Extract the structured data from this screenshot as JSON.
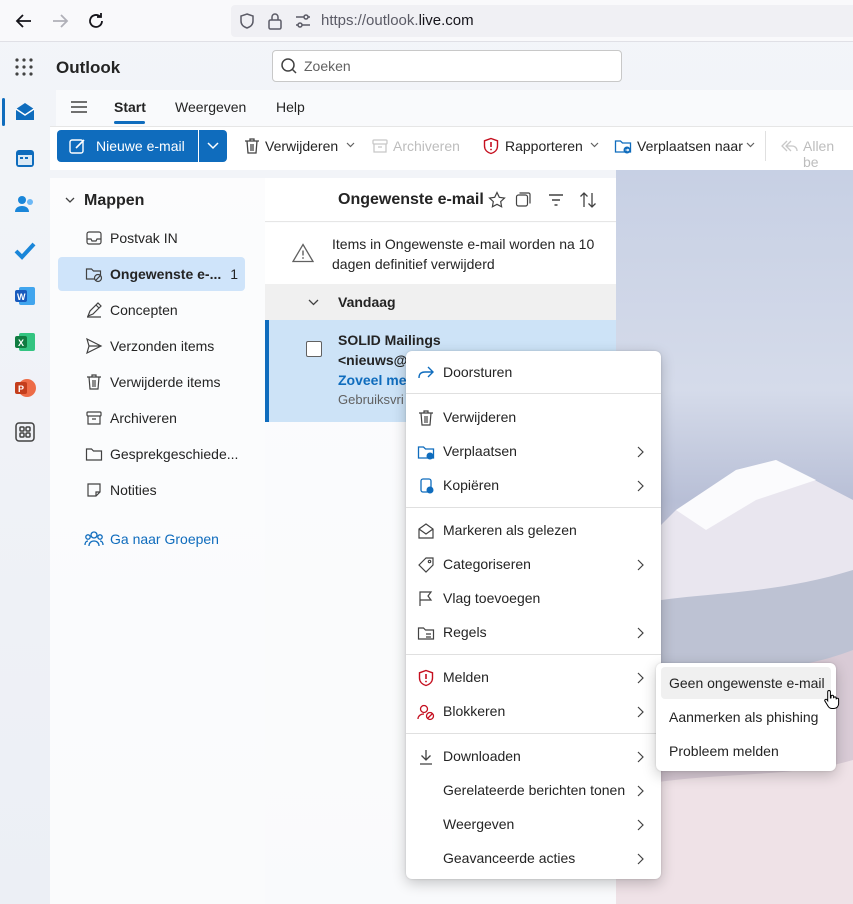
{
  "browser": {
    "url_prefix": "https://outlook.",
    "url_domain": "live.com"
  },
  "app": {
    "title": "Outlook"
  },
  "search": {
    "placeholder": "Zoeken"
  },
  "ribbon": {
    "tabs": [
      "Start",
      "Weergeven",
      "Help"
    ],
    "active_tab": "Start"
  },
  "toolbar": {
    "new_mail": "Nieuwe e-mail",
    "delete": "Verwijderen",
    "archive": "Archiveren",
    "report": "Rapporteren",
    "move_to": "Verplaatsen naar",
    "reply_all": "Allen be"
  },
  "folders": {
    "header": "Mappen",
    "items": [
      {
        "label": "Postvak IN",
        "icon": "inbox-icon"
      },
      {
        "label": "Ongewenste e-...",
        "icon": "junk-icon",
        "count": "1",
        "active": true
      },
      {
        "label": "Concepten",
        "icon": "drafts-icon"
      },
      {
        "label": "Verzonden items",
        "icon": "sent-icon"
      },
      {
        "label": "Verwijderde items",
        "icon": "trash-icon"
      },
      {
        "label": "Archiveren",
        "icon": "archive-icon"
      },
      {
        "label": "Gesprekgeschiede...",
        "icon": "folder-icon"
      },
      {
        "label": "Notities",
        "icon": "notes-icon"
      }
    ],
    "groups_link": "Ga naar Groepen"
  },
  "list": {
    "title": "Ongewenste e-mail",
    "notice": "Items in Ongewenste e-mail worden na 10 dagen definitief verwijderd",
    "group": "Vandaag",
    "mail": {
      "sender": "SOLID Mailings",
      "from": "<nieuws@",
      "subject": "Zoveel mee",
      "preview": "Gebruiksvri"
    }
  },
  "context_menu": {
    "items": [
      {
        "label": "Doorsturen",
        "icon": "forward-icon"
      },
      {
        "label": "Verwijderen",
        "icon": "trash-icon"
      },
      {
        "label": "Verplaatsen",
        "icon": "move-folder-icon",
        "submenu": true
      },
      {
        "label": "Kopiëren",
        "icon": "copy-icon",
        "submenu": true
      },
      {
        "label": "Markeren als gelezen",
        "icon": "envelope-open-icon"
      },
      {
        "label": "Categoriseren",
        "icon": "tag-icon",
        "submenu": true
      },
      {
        "label": "Vlag toevoegen",
        "icon": "flag-icon"
      },
      {
        "label": "Regels",
        "icon": "rules-icon",
        "submenu": true
      },
      {
        "label": "Melden",
        "icon": "shield-icon",
        "submenu": true
      },
      {
        "label": "Blokkeren",
        "icon": "block-icon",
        "submenu": true
      },
      {
        "label": "Downloaden",
        "icon": "download-icon",
        "submenu": true
      },
      {
        "label": "Gerelateerde berichten tonen",
        "icon": "",
        "submenu": true
      },
      {
        "label": "Weergeven",
        "icon": "",
        "submenu": true
      },
      {
        "label": "Geavanceerde acties",
        "icon": "",
        "submenu": true
      }
    ]
  },
  "submenu": {
    "items": [
      "Geen ongewenste e-mail",
      "Aanmerken als phishing",
      "Probleem melden"
    ]
  },
  "colors": {
    "accent": "#0f6cbd",
    "selected": "#cde3f7",
    "danger": "#c50f1f"
  }
}
